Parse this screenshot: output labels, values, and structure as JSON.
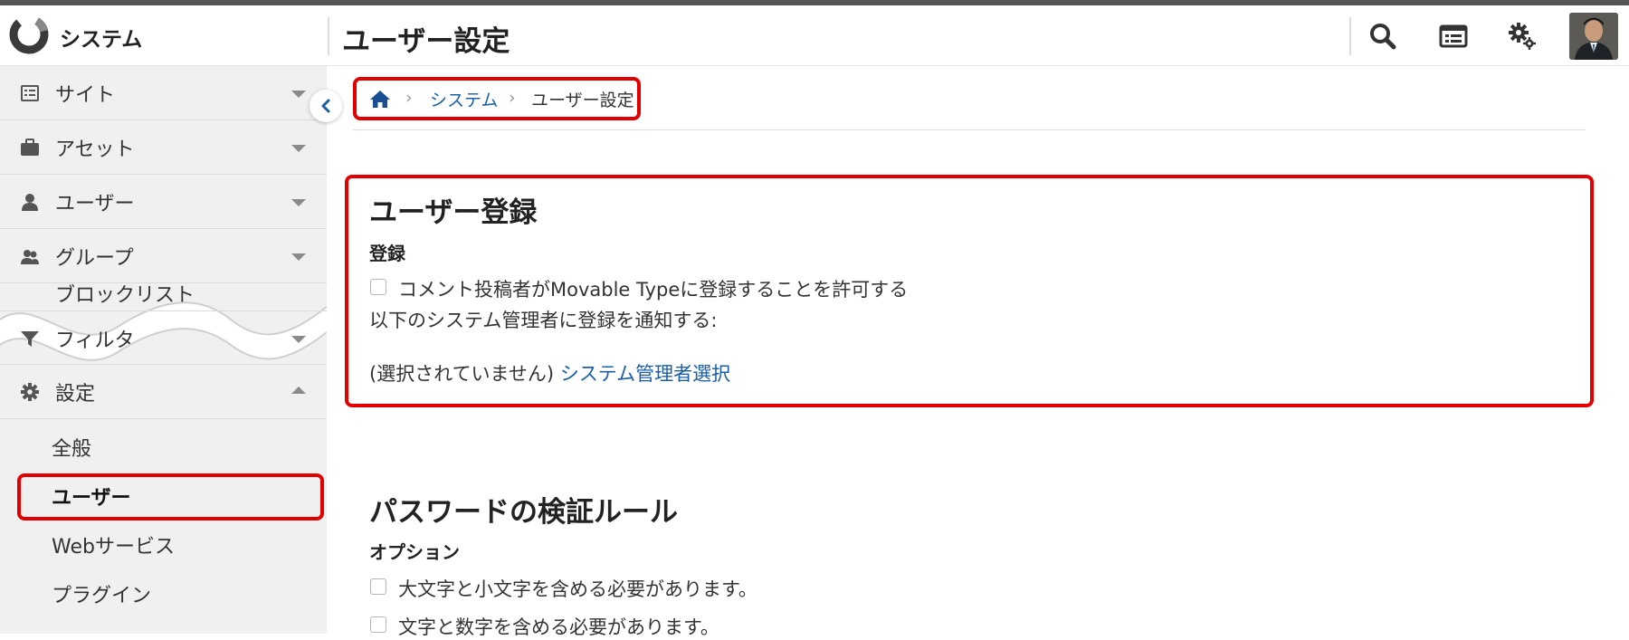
{
  "app": {
    "name": "システム",
    "page_title": "ユーザー設定"
  },
  "header": {
    "icons": [
      "search-icon",
      "dashboard-icon",
      "gear-icon",
      "user-avatar"
    ]
  },
  "sidebar": {
    "items": [
      {
        "label": "サイト",
        "icon": "site-icon"
      },
      {
        "label": "アセット",
        "icon": "briefcase-icon"
      },
      {
        "label": "ユーザー",
        "icon": "user-icon"
      },
      {
        "label": "グループ",
        "icon": "group-icon"
      },
      {
        "label": "ブロックリスト",
        "icon": "blocklist-icon"
      },
      {
        "label": "フィルタ",
        "icon": "filter-icon"
      },
      {
        "label": "設定",
        "icon": "gear-icon"
      }
    ],
    "settings_sub": [
      "全般",
      "ユーザー",
      "Webサービス",
      "プラグイン"
    ]
  },
  "breadcrumb": {
    "link": "システム",
    "current": "ユーザー設定"
  },
  "registration": {
    "title": "ユーザー登録",
    "subtitle": "登録",
    "allow_label": "コメント投稿者がMovable Typeに登録することを許可する",
    "notify_label": "以下のシステム管理者に登録を通知する:",
    "none_selected": "(選択されていません)",
    "select_admin_link": "システム管理者選択"
  },
  "password": {
    "title": "パスワードの検証ルール",
    "subtitle": "オプション",
    "options": [
      "大文字と小文字を含める必要があります。",
      "文字と数字を含める必要があります。"
    ]
  },
  "colors": {
    "highlight": "#e30000",
    "link": "#1a5fa6",
    "sidebar_bg": "#f0f0f0"
  }
}
